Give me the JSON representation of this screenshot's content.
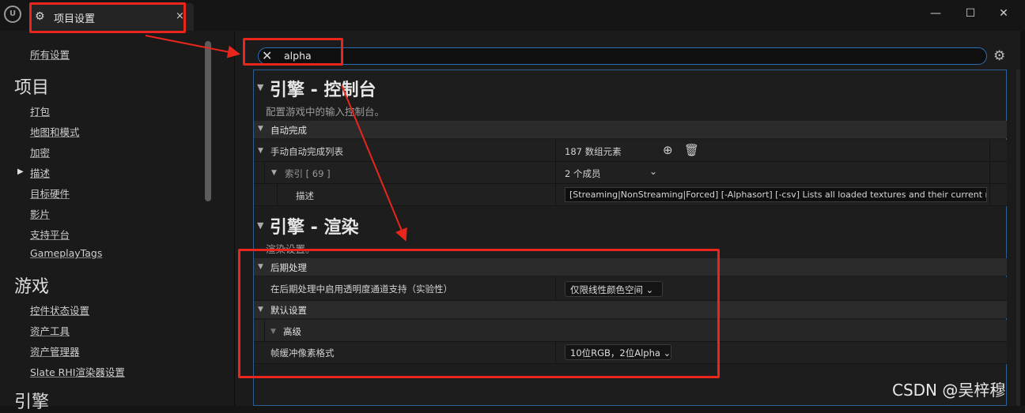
{
  "window": {
    "tab_title": "项目设置",
    "tab_close": "×",
    "logo_text": "U",
    "minimize": "—",
    "maximize": "☐",
    "close": "✕"
  },
  "sidebar": {
    "all_settings": "所有设置",
    "project_heading": "项目",
    "project_items": [
      "打包",
      "地图和模式",
      "加密",
      "描述",
      "目标硬件",
      "影片",
      "支持平台",
      "GameplayTags"
    ],
    "selected_item": "描述",
    "game_heading": "游戏",
    "game_items": [
      "控件状态设置",
      "资产工具",
      "资产管理器",
      "Slate RHI渲染器设置"
    ],
    "engine_heading": "引擎"
  },
  "search": {
    "value": "alpha",
    "clear_icon": "close-icon"
  },
  "sections": [
    {
      "title": "引擎 - 控制台",
      "description": "配置游戏中的输入控制台。",
      "category": "自动完成",
      "array_label": "手动自动完成列表",
      "array_count": "187 数组元素",
      "index_label": "索引 [ 69 ]",
      "index_members": "2 个成员",
      "desc_label": "描述",
      "desc_value": "[Streaming|NonStreaming|Forced] [-Alphasort] [-csv] Lists all loaded textures and their current memor"
    },
    {
      "title": "引擎 - 渲染",
      "description": "渲染设置。",
      "category_post": "后期处理",
      "post_prop_label": "在后期处理中启用透明度通道支持（实验性）",
      "post_prop_value": "仅限线性颜色空间",
      "category_default": "默认设置",
      "sub_category": "高级",
      "fb_label": "帧缓冲像素格式",
      "fb_value": "10位RGB，2位Alpha"
    }
  ],
  "watermark": "CSDN @吴梓穆",
  "colors": {
    "annotation_red": "#e8261c",
    "search_border": "#2a6fb3"
  }
}
